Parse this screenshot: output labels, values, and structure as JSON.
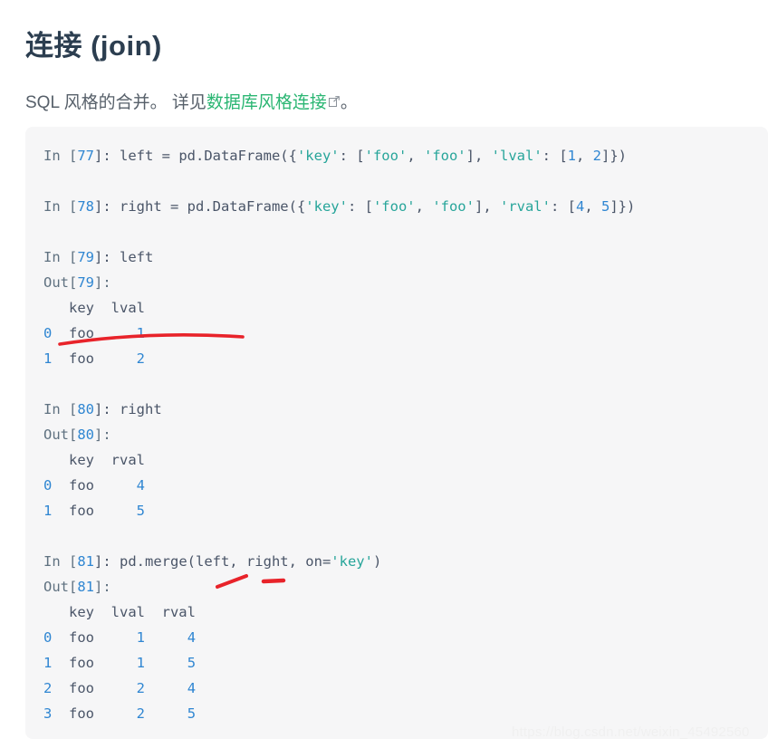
{
  "heading": {
    "title": "连接 (join)"
  },
  "intro": {
    "before": "SQL 风格的合并。 详见",
    "link_text": "数据库风格连接",
    "link_icon": "external-link-icon",
    "after": "。"
  },
  "code_block": {
    "lines": [
      {
        "id": "in-77",
        "segments": [
          {
            "text": "In [",
            "cls": "tok-prompt"
          },
          {
            "text": "77",
            "cls": "tok-num"
          },
          {
            "text": "]: left = pd.DataFrame({",
            "cls": "tok-plain"
          },
          {
            "text": "'key'",
            "cls": "tok-str"
          },
          {
            "text": ": [",
            "cls": "tok-plain"
          },
          {
            "text": "'foo'",
            "cls": "tok-str"
          },
          {
            "text": ", ",
            "cls": "tok-plain"
          },
          {
            "text": "'foo'",
            "cls": "tok-str"
          },
          {
            "text": "], ",
            "cls": "tok-plain"
          },
          {
            "text": "'lval'",
            "cls": "tok-str"
          },
          {
            "text": ": [",
            "cls": "tok-plain"
          },
          {
            "text": "1",
            "cls": "tok-num"
          },
          {
            "text": ", ",
            "cls": "tok-plain"
          },
          {
            "text": "2",
            "cls": "tok-num"
          },
          {
            "text": "]})",
            "cls": "tok-plain"
          }
        ]
      },
      {
        "id": "blank-1",
        "segments": []
      },
      {
        "id": "in-78",
        "segments": [
          {
            "text": "In [",
            "cls": "tok-prompt"
          },
          {
            "text": "78",
            "cls": "tok-num"
          },
          {
            "text": "]: right = pd.DataFrame({",
            "cls": "tok-plain"
          },
          {
            "text": "'key'",
            "cls": "tok-str"
          },
          {
            "text": ": [",
            "cls": "tok-plain"
          },
          {
            "text": "'foo'",
            "cls": "tok-str"
          },
          {
            "text": ", ",
            "cls": "tok-plain"
          },
          {
            "text": "'foo'",
            "cls": "tok-str"
          },
          {
            "text": "], ",
            "cls": "tok-plain"
          },
          {
            "text": "'rval'",
            "cls": "tok-str"
          },
          {
            "text": ": [",
            "cls": "tok-plain"
          },
          {
            "text": "4",
            "cls": "tok-num"
          },
          {
            "text": ", ",
            "cls": "tok-plain"
          },
          {
            "text": "5",
            "cls": "tok-num"
          },
          {
            "text": "]})",
            "cls": "tok-plain"
          }
        ]
      },
      {
        "id": "blank-2",
        "segments": []
      },
      {
        "id": "in-79",
        "segments": [
          {
            "text": "In [",
            "cls": "tok-prompt"
          },
          {
            "text": "79",
            "cls": "tok-num"
          },
          {
            "text": "]: left",
            "cls": "tok-plain"
          }
        ]
      },
      {
        "id": "out-79-head",
        "segments": [
          {
            "text": "Out[",
            "cls": "tok-prompt"
          },
          {
            "text": "79",
            "cls": "tok-outnum"
          },
          {
            "text": "]:",
            "cls": "tok-prompt"
          }
        ]
      },
      {
        "id": "out-79-cols",
        "segments": [
          {
            "text": "   key  lval",
            "cls": "tok-plain"
          }
        ]
      },
      {
        "id": "out-79-row-0",
        "segments": [
          {
            "text": "0",
            "cls": "tok-outnum"
          },
          {
            "text": "  foo     ",
            "cls": "tok-plain"
          },
          {
            "text": "1",
            "cls": "tok-outnum"
          }
        ]
      },
      {
        "id": "out-79-row-1",
        "segments": [
          {
            "text": "1",
            "cls": "tok-outnum"
          },
          {
            "text": "  foo     ",
            "cls": "tok-plain"
          },
          {
            "text": "2",
            "cls": "tok-outnum"
          }
        ]
      },
      {
        "id": "blank-3",
        "segments": []
      },
      {
        "id": "in-80",
        "segments": [
          {
            "text": "In [",
            "cls": "tok-prompt"
          },
          {
            "text": "80",
            "cls": "tok-num"
          },
          {
            "text": "]: right",
            "cls": "tok-plain"
          }
        ]
      },
      {
        "id": "out-80-head",
        "segments": [
          {
            "text": "Out[",
            "cls": "tok-prompt"
          },
          {
            "text": "80",
            "cls": "tok-outnum"
          },
          {
            "text": "]:",
            "cls": "tok-prompt"
          }
        ]
      },
      {
        "id": "out-80-cols",
        "segments": [
          {
            "text": "   key  rval",
            "cls": "tok-plain"
          }
        ]
      },
      {
        "id": "out-80-row-0",
        "segments": [
          {
            "text": "0",
            "cls": "tok-outnum"
          },
          {
            "text": "  foo     ",
            "cls": "tok-plain"
          },
          {
            "text": "4",
            "cls": "tok-outnum"
          }
        ]
      },
      {
        "id": "out-80-row-1",
        "segments": [
          {
            "text": "1",
            "cls": "tok-outnum"
          },
          {
            "text": "  foo     ",
            "cls": "tok-plain"
          },
          {
            "text": "5",
            "cls": "tok-outnum"
          }
        ]
      },
      {
        "id": "blank-4",
        "segments": []
      },
      {
        "id": "in-81",
        "segments": [
          {
            "text": "In [",
            "cls": "tok-prompt"
          },
          {
            "text": "81",
            "cls": "tok-num"
          },
          {
            "text": "]: pd.merge(left, right, on=",
            "cls": "tok-plain"
          },
          {
            "text": "'key'",
            "cls": "tok-str"
          },
          {
            "text": ")",
            "cls": "tok-plain"
          }
        ]
      },
      {
        "id": "out-81-head",
        "segments": [
          {
            "text": "Out[",
            "cls": "tok-prompt"
          },
          {
            "text": "81",
            "cls": "tok-outnum"
          },
          {
            "text": "]:",
            "cls": "tok-prompt"
          }
        ]
      },
      {
        "id": "out-81-cols",
        "segments": [
          {
            "text": "   key  lval  rval",
            "cls": "tok-plain"
          }
        ]
      },
      {
        "id": "out-81-row-0",
        "segments": [
          {
            "text": "0",
            "cls": "tok-outnum"
          },
          {
            "text": "  foo     ",
            "cls": "tok-plain"
          },
          {
            "text": "1",
            "cls": "tok-outnum"
          },
          {
            "text": "     ",
            "cls": "tok-plain"
          },
          {
            "text": "4",
            "cls": "tok-outnum"
          }
        ]
      },
      {
        "id": "out-81-row-1",
        "segments": [
          {
            "text": "1",
            "cls": "tok-outnum"
          },
          {
            "text": "  foo     ",
            "cls": "tok-plain"
          },
          {
            "text": "1",
            "cls": "tok-outnum"
          },
          {
            "text": "     ",
            "cls": "tok-plain"
          },
          {
            "text": "5",
            "cls": "tok-outnum"
          }
        ]
      },
      {
        "id": "out-81-row-2",
        "segments": [
          {
            "text": "2",
            "cls": "tok-outnum"
          },
          {
            "text": "  foo     ",
            "cls": "tok-plain"
          },
          {
            "text": "2",
            "cls": "tok-outnum"
          },
          {
            "text": "     ",
            "cls": "tok-plain"
          },
          {
            "text": "4",
            "cls": "tok-outnum"
          }
        ]
      },
      {
        "id": "out-81-row-3",
        "segments": [
          {
            "text": "3",
            "cls": "tok-outnum"
          },
          {
            "text": "  foo     ",
            "cls": "tok-plain"
          },
          {
            "text": "2",
            "cls": "tok-outnum"
          },
          {
            "text": "     ",
            "cls": "tok-plain"
          },
          {
            "text": "5",
            "cls": "tok-outnum"
          }
        ]
      }
    ]
  },
  "annotations": [
    {
      "id": "underline-lval-1",
      "type": "stroke",
      "color": "#e8232a"
    },
    {
      "id": "slash-under-left",
      "type": "stroke",
      "color": "#e8232a"
    },
    {
      "id": "dash-under-right",
      "type": "stroke",
      "color": "#e8232a"
    }
  ],
  "watermark": {
    "text": "https://blog.csdn.net/weixin_45492560"
  },
  "colors": {
    "title": "#2c3e50",
    "body_text": "#57606a",
    "link": "#2bb673",
    "code_bg": "#f6f6f7",
    "code_text": "#4a5568",
    "number": "#2f86d2",
    "string": "#27a59a",
    "annotation": "#e8232a"
  }
}
